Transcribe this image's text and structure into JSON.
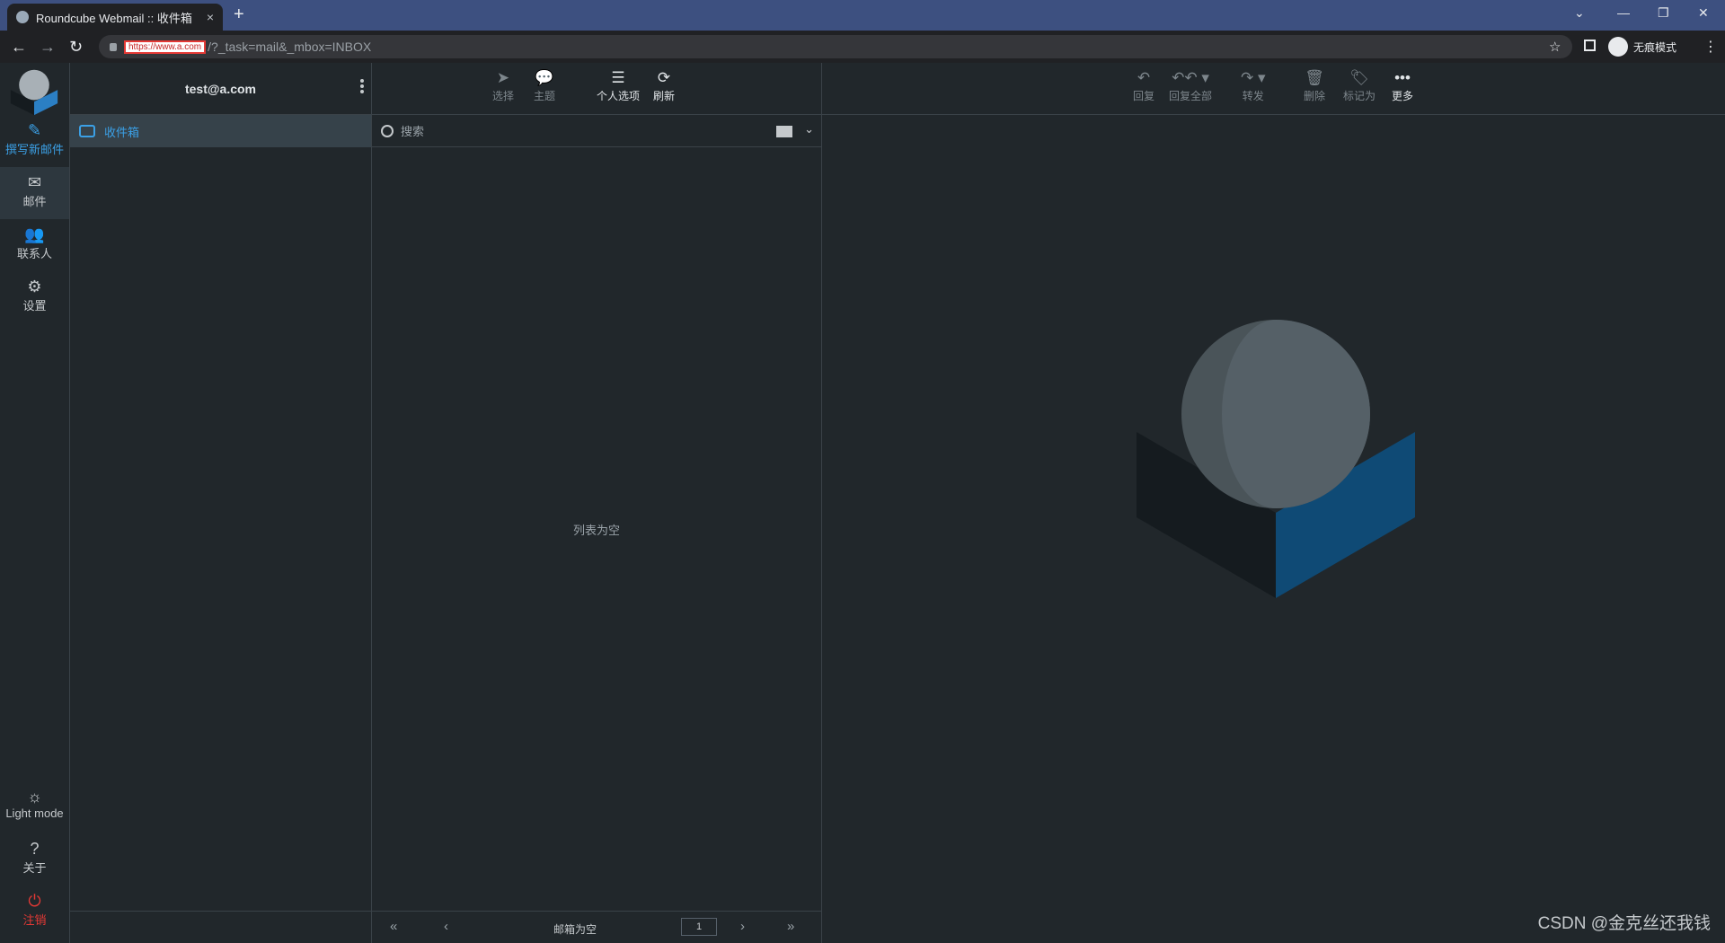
{
  "browser": {
    "tab_title": "Roundcube Webmail :: 收件箱",
    "tab_close": "×",
    "new_tab": "+",
    "url_host": "https://www.a.com",
    "url_path": "/?_task=mail&_mbox=INBOX",
    "incognito_label": "无痕模式",
    "star_icon": "star-icon"
  },
  "nav": {
    "compose": "撰写新邮件",
    "mail": "邮件",
    "contacts": "联系人",
    "settings": "设置",
    "light_mode": "Light mode",
    "about": "关于",
    "logout": "注销"
  },
  "folders": {
    "account": "test@a.com",
    "items": [
      {
        "label": "收件箱",
        "icon": "inbox-icon"
      }
    ]
  },
  "list": {
    "toolbar": {
      "select": "选择",
      "threads": "主题",
      "options": "个人选项",
      "refresh": "刷新"
    },
    "search_placeholder": "搜索",
    "empty_message": "列表为空",
    "footer": {
      "status": "邮箱为空",
      "page": "1"
    }
  },
  "preview": {
    "toolbar": {
      "reply": "回复",
      "reply_all": "回复全部",
      "forward": "转发",
      "delete": "删除",
      "mark": "标记为",
      "more": "更多"
    }
  },
  "watermark": "CSDN @金克丝还我钱",
  "colors": {
    "accent": "#3ba0e6",
    "danger": "#e53935",
    "background": "#21272b"
  }
}
